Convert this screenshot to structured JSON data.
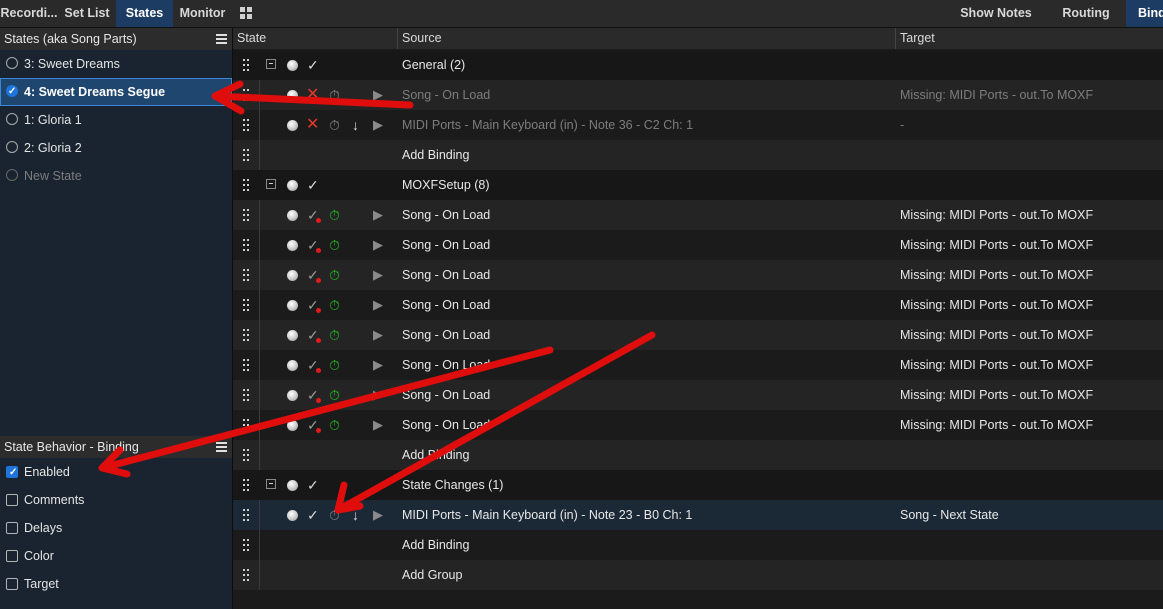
{
  "tabs": [
    {
      "label": "Recordi..."
    },
    {
      "label": "Set List"
    },
    {
      "label": "States"
    },
    {
      "label": "Monitor"
    }
  ],
  "right_tabs": [
    {
      "label": "Show Notes"
    },
    {
      "label": "Routing"
    },
    {
      "label": "Bind"
    }
  ],
  "states_panel": {
    "title": "States (aka Song Parts)",
    "items": [
      {
        "label": "3: Sweet Dreams"
      },
      {
        "label": "4: Sweet Dreams Segue",
        "selected": true
      },
      {
        "label": "1: Gloria 1"
      },
      {
        "label": "2: Gloria 2"
      },
      {
        "label": "New State"
      }
    ]
  },
  "behavior_panel": {
    "title": "State Behavior - Binding",
    "options": [
      {
        "label": "Enabled",
        "checked": true
      },
      {
        "label": "Comments",
        "checked": false
      },
      {
        "label": "Delays",
        "checked": false
      },
      {
        "label": "Color",
        "checked": false
      },
      {
        "label": "Target",
        "checked": false
      }
    ]
  },
  "table": {
    "columns": [
      "State",
      "Source",
      "Target"
    ],
    "rows": [
      {
        "kind": "group",
        "source": "General (2)",
        "target": ""
      },
      {
        "kind": "binding",
        "source": "Song - On Load",
        "target": "Missing: MIDI Ports - out.To MOXF",
        "disabled": true
      },
      {
        "kind": "binding",
        "source": "MIDI Ports - Main Keyboard (in) - Note 36 - C2 Ch: 1",
        "target": "-",
        "disabled": true
      },
      {
        "kind": "add",
        "source": "Add Binding",
        "target": ""
      },
      {
        "kind": "group",
        "source": "MOXFSetup (8)",
        "target": ""
      },
      {
        "kind": "binding",
        "source": "Song - On Load",
        "target": "Missing: MIDI Ports - out.To MOXF"
      },
      {
        "kind": "binding",
        "source": "Song - On Load",
        "target": "Missing: MIDI Ports - out.To MOXF"
      },
      {
        "kind": "binding",
        "source": "Song - On Load",
        "target": "Missing: MIDI Ports - out.To MOXF"
      },
      {
        "kind": "binding",
        "source": "Song - On Load",
        "target": "Missing: MIDI Ports - out.To MOXF"
      },
      {
        "kind": "binding",
        "source": "Song - On Load",
        "target": "Missing: MIDI Ports - out.To MOXF"
      },
      {
        "kind": "binding",
        "source": "Song - On Load",
        "target": "Missing: MIDI Ports - out.To MOXF"
      },
      {
        "kind": "binding",
        "source": "Song - On Load",
        "target": "Missing: MIDI Ports - out.To MOXF"
      },
      {
        "kind": "binding",
        "source": "Song - On Load",
        "target": "Missing: MIDI Ports - out.To MOXF"
      },
      {
        "kind": "add",
        "source": "Add Binding",
        "target": ""
      },
      {
        "kind": "group",
        "source": "State Changes (1)",
        "target": ""
      },
      {
        "kind": "binding",
        "source": "MIDI Ports - Main Keyboard (in) - Note 23 - B0 Ch: 1",
        "target": "Song - Next State",
        "selected": true
      },
      {
        "kind": "add",
        "source": "Add Binding",
        "target": ""
      },
      {
        "kind": "add",
        "source": "Add Group",
        "target": ""
      }
    ]
  },
  "colors": {
    "accent": "#1e74d8",
    "arrow": "#e00d0d",
    "timer_green": "#22c322",
    "disabled_x": "#e23a2a"
  }
}
